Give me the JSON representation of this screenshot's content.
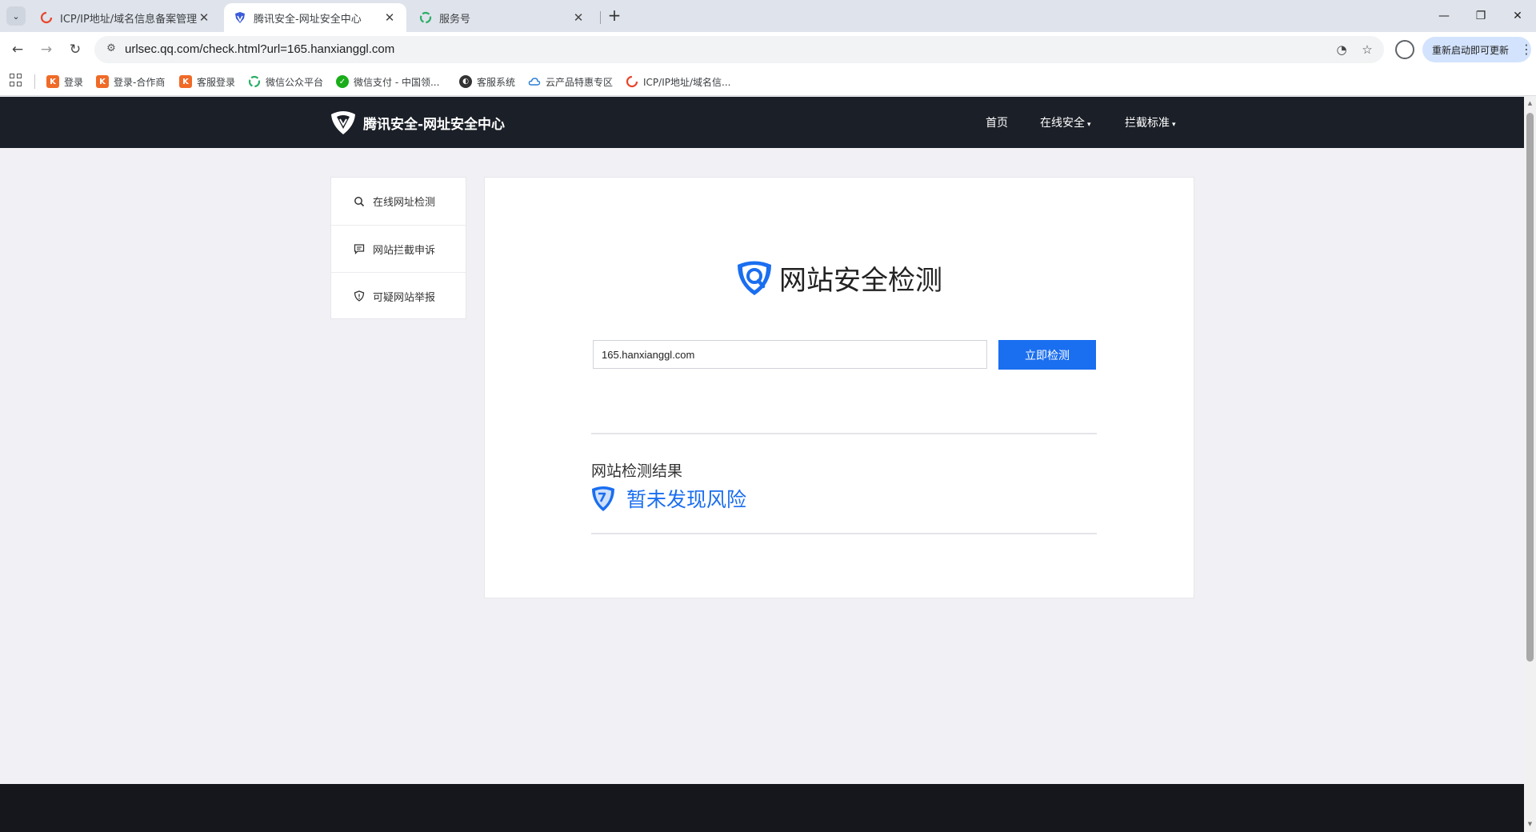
{
  "browser": {
    "tabs": [
      {
        "title": "ICP/IP地址/域名信息备案管理系",
        "icon": "icp-favicon",
        "active": false
      },
      {
        "title": "腾讯安全-网址安全中心",
        "icon": "tencent-security-favicon",
        "active": true
      },
      {
        "title": "服务号",
        "icon": "wechat-service-favicon",
        "active": false
      }
    ],
    "close_glyph": "✕",
    "new_tab_glyph": "+",
    "window_controls": {
      "minimize": "—",
      "restore": "❐",
      "close": "✕"
    },
    "address_bar": {
      "url": "urlsec.qq.com/check.html?url=165.hanxianggl.com"
    },
    "update_button": "重新启动即可更新",
    "bookmarks": [
      {
        "label": "登录",
        "icon": "k-icon",
        "color": "#f06a28"
      },
      {
        "label": "登录-合作商",
        "icon": "k-icon",
        "color": "#f06a28"
      },
      {
        "label": "客服登录",
        "icon": "k-icon",
        "color": "#f06a28"
      },
      {
        "label": "微信公众平台",
        "icon": "wechat-mp-icon",
        "color": "#2aae67"
      },
      {
        "label": "微信支付 - 中国领...",
        "icon": "wechat-pay-icon",
        "color": "#1aad19"
      },
      {
        "label": "客服系统",
        "icon": "support-icon",
        "color": "#333333"
      },
      {
        "label": "云产品特惠专区",
        "icon": "cloud-icon",
        "color": "#2a7cd6"
      },
      {
        "label": "ICP/IP地址/域名信...",
        "icon": "icp-icon",
        "color": "#e8452a"
      }
    ]
  },
  "site": {
    "brand": "腾讯安全-网址安全中心",
    "nav": [
      {
        "label": "首页",
        "has_caret": false
      },
      {
        "label": "在线安全",
        "has_caret": true
      },
      {
        "label": "拦截标准",
        "has_caret": true
      }
    ],
    "caret": "▾",
    "sidebar": [
      {
        "label": "在线网址检测",
        "icon": "search-icon"
      },
      {
        "label": "网站拦截申诉",
        "icon": "message-icon"
      },
      {
        "label": "可疑网站举报",
        "icon": "shield-icon"
      }
    ],
    "main": {
      "title": "网站安全检测",
      "input_value": "165.hanxianggl.com",
      "check_button": "立即检测",
      "result_label": "网站检测结果",
      "result_text": "暂未发现风险"
    },
    "colors": {
      "accent": "#1a6ef0",
      "header_bg": "#1b1f27",
      "page_bg": "#f0f0f5"
    }
  }
}
